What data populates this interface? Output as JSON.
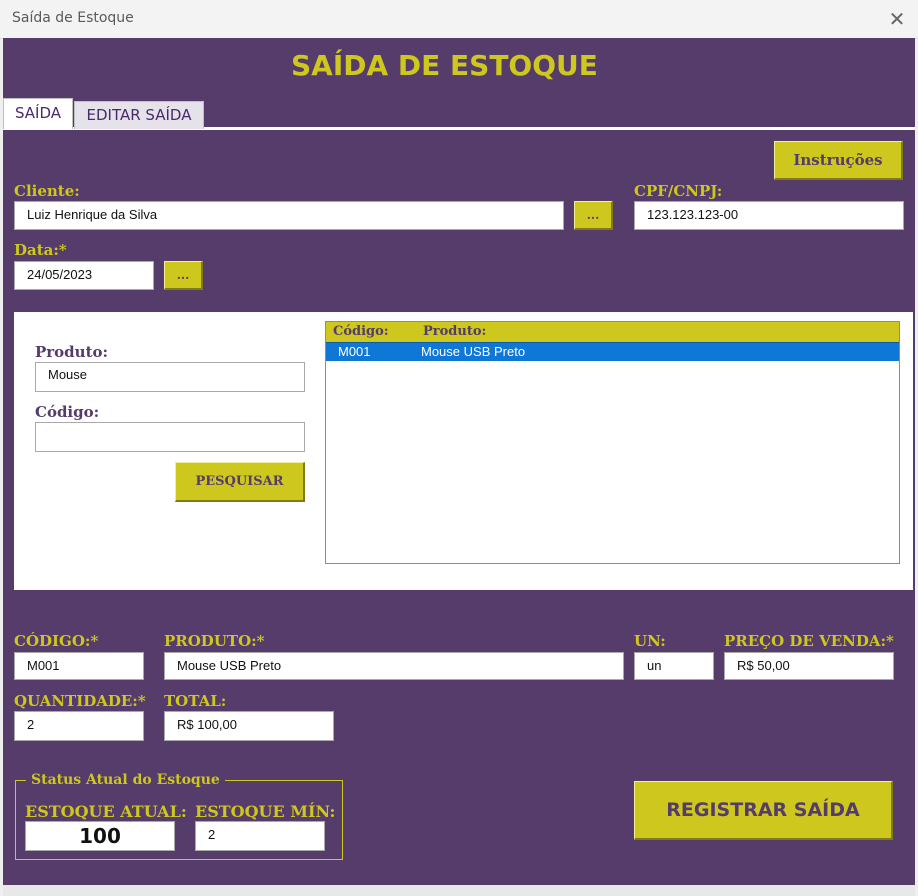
{
  "window": {
    "title": "Saída de Estoque",
    "close_glyph": "✕"
  },
  "header": {
    "title": "SAÍDA DE ESTOQUE"
  },
  "tabs": [
    {
      "label": "SAÍDA"
    },
    {
      "label": "EDITAR SAÍDA"
    }
  ],
  "buttons": {
    "instrucoes": "Instruções",
    "cliente_lookup": "...",
    "data_lookup": "...",
    "pesquisar": "PESQUISAR",
    "registrar": "REGISTRAR SAÍDA"
  },
  "form": {
    "cliente_label": "Cliente:",
    "cliente_value": "Luiz Henrique da Silva",
    "cpf_label": "CPF/CNPJ:",
    "cpf_value": "123.123.123-00",
    "data_label": "Data:*",
    "data_value": "24/05/2023"
  },
  "search": {
    "produto_label": "Produto:",
    "produto_value": "Mouse",
    "codigo_label": "Código:",
    "codigo_value": ""
  },
  "results": {
    "columns": [
      "Código:",
      "Produto:"
    ],
    "rows": [
      {
        "codigo": "M001",
        "produto": "Mouse USB Preto"
      }
    ]
  },
  "detail": {
    "codigo_label": "CÓDIGO:*",
    "codigo_value": "M001",
    "produto_label": "PRODUTO:*",
    "produto_value": "Mouse USB Preto",
    "un_label": "UN:",
    "un_value": "un",
    "preco_label": "PREÇO DE VENDA:*",
    "preco_value": "R$ 50,00",
    "quantidade_label": "QUANTIDADE:*",
    "quantidade_value": "2",
    "total_label": "TOTAL:",
    "total_value": "R$ 100,00"
  },
  "estoque": {
    "group_label": "Status Atual do Estoque",
    "atual_label": "ESTOQUE ATUAL:",
    "atual_value": "100",
    "min_label": "ESTOQUE MÍN:",
    "min_value": "2"
  },
  "colors": {
    "background": "#553c6a",
    "accent": "#cdc71e",
    "selection": "#0f78d7"
  }
}
